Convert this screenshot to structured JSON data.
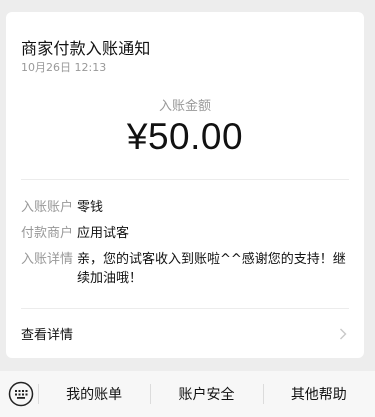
{
  "notification": {
    "title": "商家付款入账通知",
    "time": "10月26日 12:13",
    "amount_label": "入账金额",
    "amount_value": "¥50.00",
    "details": [
      {
        "key": "入账账户",
        "value": "零钱"
      },
      {
        "key": "付款商户",
        "value": "应用试客"
      },
      {
        "key": "入账详情",
        "value": "亲，您的试客收入到账啦^^感谢您的支持！继续加油哦！"
      }
    ],
    "view_detail_label": "查看详情",
    "view_detail_icon": "chevron-right-icon"
  },
  "bottom_menu": {
    "keyboard_icon": "keyboard-icon",
    "items": [
      "我的账单",
      "账户安全",
      "其他帮助"
    ]
  },
  "colors": {
    "background": "#ededed",
    "card": "#ffffff",
    "secondary_text": "#999999",
    "primary_text": "#111111"
  }
}
